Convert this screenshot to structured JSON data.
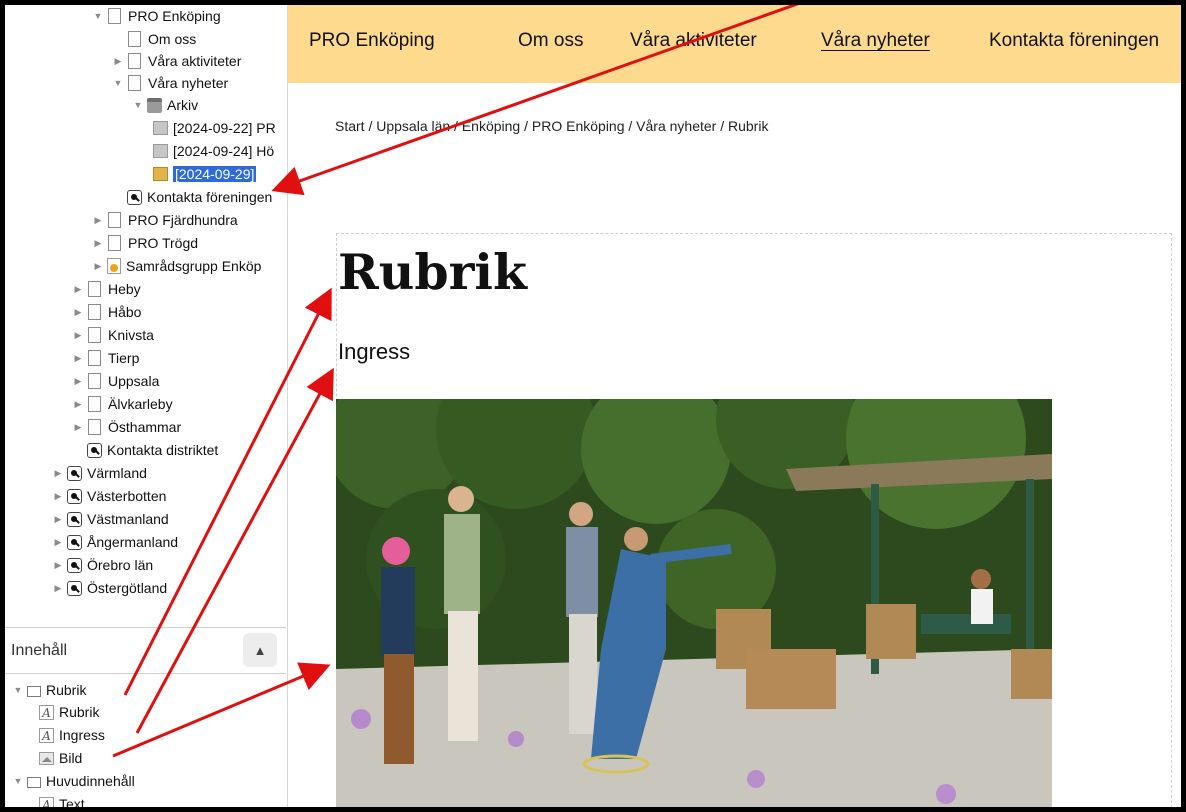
{
  "tree": [
    {
      "label": "PRO Enköping",
      "icon": "page-icon",
      "expanded": true
    },
    {
      "label": "Om oss",
      "icon": "page-icon"
    },
    {
      "label": "Våra aktiviteter",
      "icon": "page-icon",
      "collapsed": true
    },
    {
      "label": "Våra nyheter",
      "icon": "page-icon",
      "expanded": true
    },
    {
      "label": "Arkiv",
      "icon": "archive-icon",
      "expanded": true
    },
    {
      "label": "[2024-09-22] PR",
      "icon": "news-item-icon"
    },
    {
      "label": "[2024-09-24] Hö",
      "icon": "news-item-icon"
    },
    {
      "label": "[2024-09-29]",
      "icon": "news-item-edit-icon",
      "selected": true
    },
    {
      "label": "Kontakta föreningen",
      "icon": "contact-page-icon"
    },
    {
      "label": "PRO Fjärdhundra",
      "icon": "page-icon",
      "collapsed": true
    },
    {
      "label": "PRO Trögd",
      "icon": "page-icon",
      "collapsed": true
    },
    {
      "label": "Samrådsgrupp Enköp",
      "icon": "group-page-icon",
      "collapsed": true
    },
    {
      "label": "Heby",
      "icon": "page-icon",
      "collapsed": true
    },
    {
      "label": "Håbo",
      "icon": "page-icon",
      "collapsed": true
    },
    {
      "label": "Knivsta",
      "icon": "page-icon",
      "collapsed": true
    },
    {
      "label": "Tierp",
      "icon": "page-icon",
      "collapsed": true
    },
    {
      "label": "Uppsala",
      "icon": "page-icon",
      "collapsed": true
    },
    {
      "label": "Älvkarleby",
      "icon": "page-icon",
      "collapsed": true
    },
    {
      "label": "Östhammar",
      "icon": "page-icon",
      "collapsed": true
    },
    {
      "label": "Kontakta distriktet",
      "icon": "contact-page-icon"
    },
    {
      "label": "Värmland",
      "icon": "contact-page-icon",
      "collapsed": true
    },
    {
      "label": "Västerbotten",
      "icon": "contact-page-icon",
      "collapsed": true
    },
    {
      "label": "Västmanland",
      "icon": "contact-page-icon",
      "collapsed": true
    },
    {
      "label": "Ångermanland",
      "icon": "contact-page-icon",
      "collapsed": true
    },
    {
      "label": "Örebro län",
      "icon": "contact-page-icon",
      "collapsed": true
    },
    {
      "label": "Östergötland",
      "icon": "contact-page-icon",
      "collapsed": true
    }
  ],
  "content_panel": {
    "title": "Innehåll",
    "sort_icon": "up-down-arrows-icon",
    "items": [
      {
        "label": "Rubrik",
        "icon": "group-icon",
        "expanded": true
      },
      {
        "label": "Rubrik",
        "icon": "text-field-icon"
      },
      {
        "label": "Ingress",
        "icon": "text-field-icon"
      },
      {
        "label": "Bild",
        "icon": "image-field-icon"
      },
      {
        "label": "Huvudinnehåll",
        "icon": "group-icon",
        "expanded": true
      },
      {
        "label": "Text",
        "icon": "text-field-icon"
      }
    ]
  },
  "site_nav": {
    "brand": "PRO Enköping",
    "links": [
      "Om oss",
      "Våra aktiviteter",
      "Våra nyheter",
      "Kontakta föreningen"
    ],
    "active": "Våra nyheter",
    "background": "#fdda8e"
  },
  "breadcrumb": "Start / Uppsala län / Enköping / PRO Enköping / Våra nyheter / Rubrik",
  "article": {
    "title": "Rubrik",
    "ingress": "Ingress"
  },
  "annotation_color": "#e01010"
}
